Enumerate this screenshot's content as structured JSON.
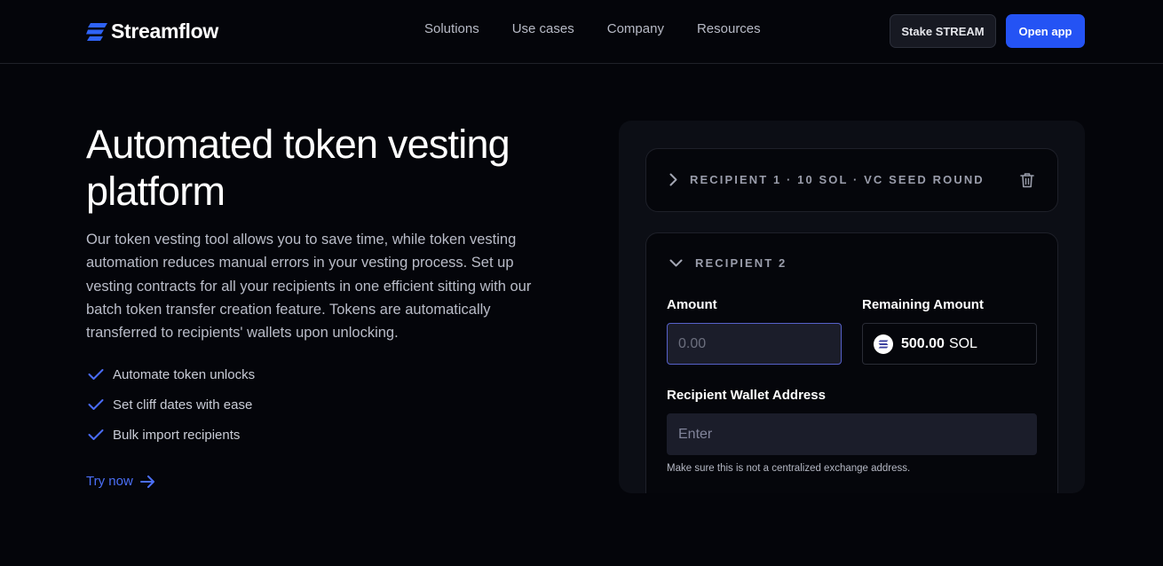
{
  "header": {
    "brand": "Streamflow",
    "nav": [
      "Solutions",
      "Use cases",
      "Company",
      "Resources"
    ],
    "stake_label": "Stake STREAM",
    "open_label": "Open app",
    "accent": "#2453f4"
  },
  "hero": {
    "title": "Automated token vesting platform",
    "description": "Our token vesting tool allows you to save time, while token vesting automation reduces manual errors in your vesting process. Set up vesting contracts for all your recipients in one efficient sitting with our batch token transfer creation feature. Tokens are automatically transferred to recipients' wallets upon unlocking.",
    "features": [
      "Automate token unlocks",
      "Set cliff dates with ease",
      "Bulk import recipients"
    ],
    "cta": "Try now"
  },
  "form": {
    "recipient1": {
      "title": "RECIPIENT 1 · 10 SOL · VC SEED ROUND",
      "collapsed": true
    },
    "recipient2": {
      "title": "RECIPIENT 2",
      "amount_label": "Amount",
      "amount_value": "",
      "amount_placeholder": "0.00",
      "remaining_label": "Remaining Amount",
      "remaining_value": "500.00",
      "remaining_unit": "SOL",
      "wallet_label": "Recipient Wallet Address",
      "wallet_value": "",
      "wallet_placeholder": "Enter",
      "wallet_hint": "Make sure this is not a centralized exchange address."
    }
  },
  "icons": {
    "logo": "streamflow-logo-icon",
    "check": "check-icon",
    "arrow": "arrow-right-icon",
    "chevron_right": "chevron-right-icon",
    "chevron_down": "chevron-down-icon",
    "trash": "trash-icon",
    "token": "solana-icon"
  }
}
